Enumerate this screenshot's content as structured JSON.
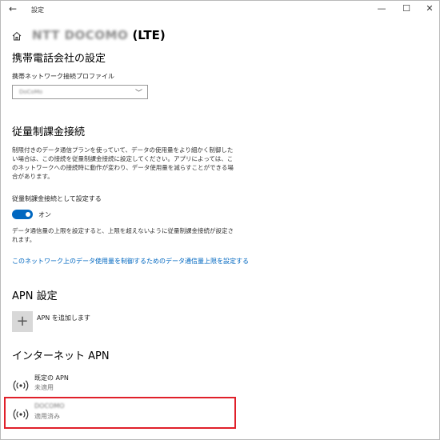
{
  "window": {
    "back_glyph": "←",
    "app_name": "設定",
    "minimize_glyph": "—",
    "maximize_glyph": "☐",
    "close_glyph": "✕"
  },
  "header": {
    "connection_name": "NTT DOCOMO",
    "connection_suffix": " (LTE)",
    "home_icon": "home-icon"
  },
  "carrier_section": {
    "title": "携帯電話会社の設定",
    "profile_label": "携帯ネットワーク接続プロファイル",
    "profile_value": "DoCoMo",
    "chevron": "﹀"
  },
  "metered_section": {
    "title": "従量制課金接続",
    "description": "制限付きのデータ通信プランを使っていて、データの使用量をより細かく制御したい場合は、この接続を従量制課金接続に設定してください。アプリによっては、このネットワークへの接続時に動作が変わり、データ使用量を減らすことができる場合があります。",
    "toggle_label": "従量制課金接続として設定する",
    "toggle_state": "オン",
    "toggle_on": true,
    "limit_description": "データ通信量の上限を設定すると、上限を超えないように従量制課金接続が設定されます。",
    "limit_link": "このネットワーク上のデータ使用量を制御するためのデータ通信量上限を設定する"
  },
  "apn_settings": {
    "title": "APN 設定",
    "add_glyph": "+",
    "add_label": "APN を追加します"
  },
  "internet_apn": {
    "title": "インターネット APN",
    "items": [
      {
        "name": "既定の APN",
        "status": "未適用",
        "icon": "cellular-signal-icon"
      },
      {
        "name": "DOCOMO",
        "status": "適用済み",
        "icon": "cellular-signal-icon"
      }
    ]
  },
  "colors": {
    "accent": "#0067c0",
    "highlight_border": "#e0202a"
  }
}
